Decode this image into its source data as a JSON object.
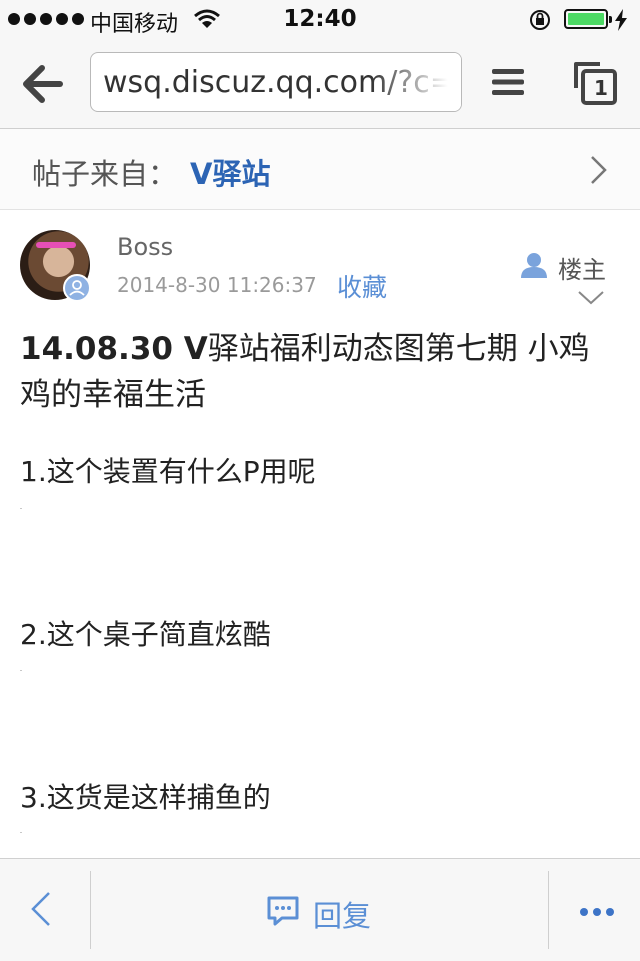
{
  "status_bar": {
    "carrier": "中国移动",
    "time": "12:40",
    "battery_level": 1.0
  },
  "browser": {
    "url": "wsq.discuz.qq.com/?c=index&a=viewthread",
    "tab_count": "1"
  },
  "source": {
    "label": "帖子来自：",
    "name": "V驿站"
  },
  "post": {
    "author": "Boss",
    "time": "2014-8-30 11:26:37",
    "favorite_label": "收藏",
    "role_label": "楼主",
    "title_bold": "14.08.30 V",
    "title_rest": "驿站福利动态图第七期 小鸡鸡的幸福生活",
    "paragraphs": [
      "1.这个装置有什么P用呢",
      "2.这个桌子简直炫酷",
      "3.这货是这样捕鱼的"
    ]
  },
  "bottom_bar": {
    "reply_label": "回复"
  },
  "colors": {
    "accent": "#2c64b4",
    "link": "#5b8fd5",
    "battery": "#4cd964"
  },
  "icons": [
    "back-arrow-icon",
    "menu-icon",
    "tabs-icon",
    "chevron-right-icon",
    "user-icon",
    "chevron-down-icon",
    "chevron-left-icon",
    "reply-bubble-icon",
    "more-icon",
    "wifi-icon",
    "rotation-lock-icon",
    "charging-icon"
  ]
}
